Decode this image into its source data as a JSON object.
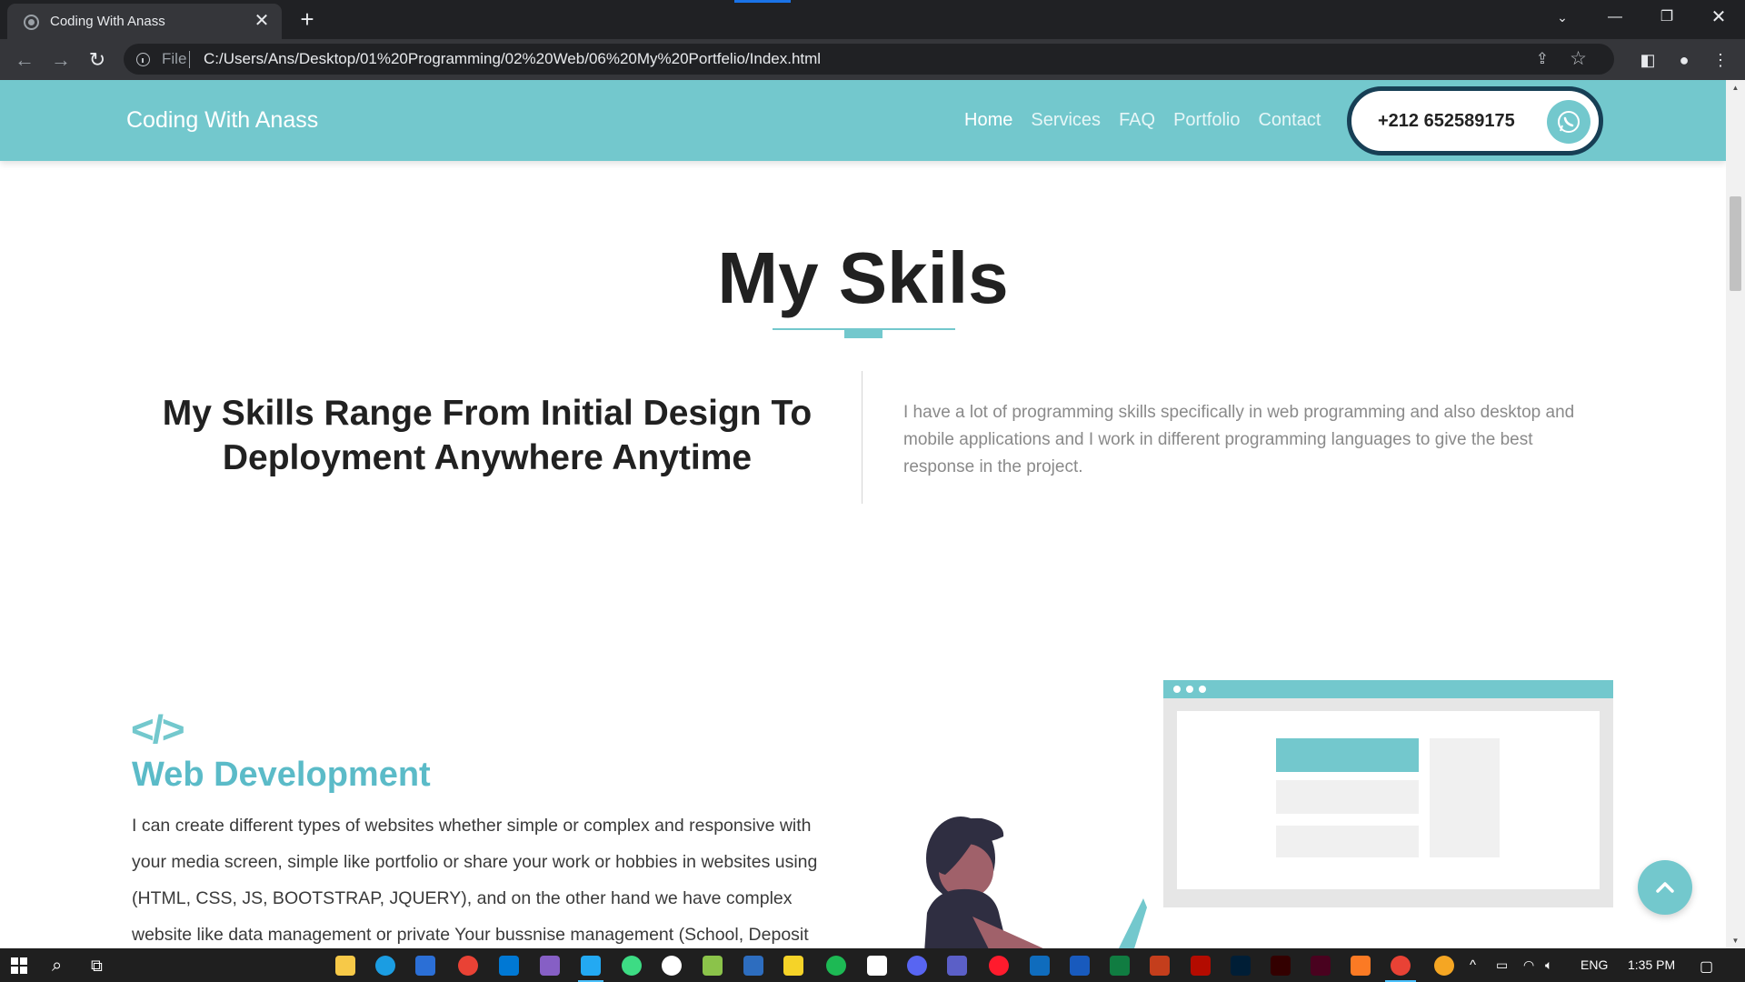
{
  "browser": {
    "tab_title": "Coding With Anass",
    "url_scheme": "File",
    "url": "C:/Users/Ans/Desktop/01%20Programming/02%20Web/06%20My%20Portfelio/Index.html"
  },
  "site": {
    "brand": "Coding With Anass",
    "nav": [
      {
        "label": "Home",
        "active": true
      },
      {
        "label": "Services"
      },
      {
        "label": "FAQ"
      },
      {
        "label": "Portfolio"
      },
      {
        "label": "Contact"
      }
    ],
    "phone": "+212 652589175",
    "accent_color": "#73c8cd",
    "dark_color": "#173f55"
  },
  "skills": {
    "title": "My Skils",
    "heading": "My Skills Range From Initial Design To Deployment Anywhere Anytime",
    "intro": "I have a lot of programming skills specifically in web programming and also desktop and mobile applications and I work in different programming languages to give the best response in the project.",
    "item_title": "Web Development",
    "item_text": "I can create different types of websites whether simple or complex and responsive with your media screen, simple like portfolio or share your work or hobbies in websites using (HTML, CSS, JS, BOOTSTRAP, JQUERY), and on the other hand we have complex website like data management or private Your bussnise management (School, Deposit"
  },
  "taskbar": {
    "language": "ENG",
    "time": "1:35 PM"
  }
}
